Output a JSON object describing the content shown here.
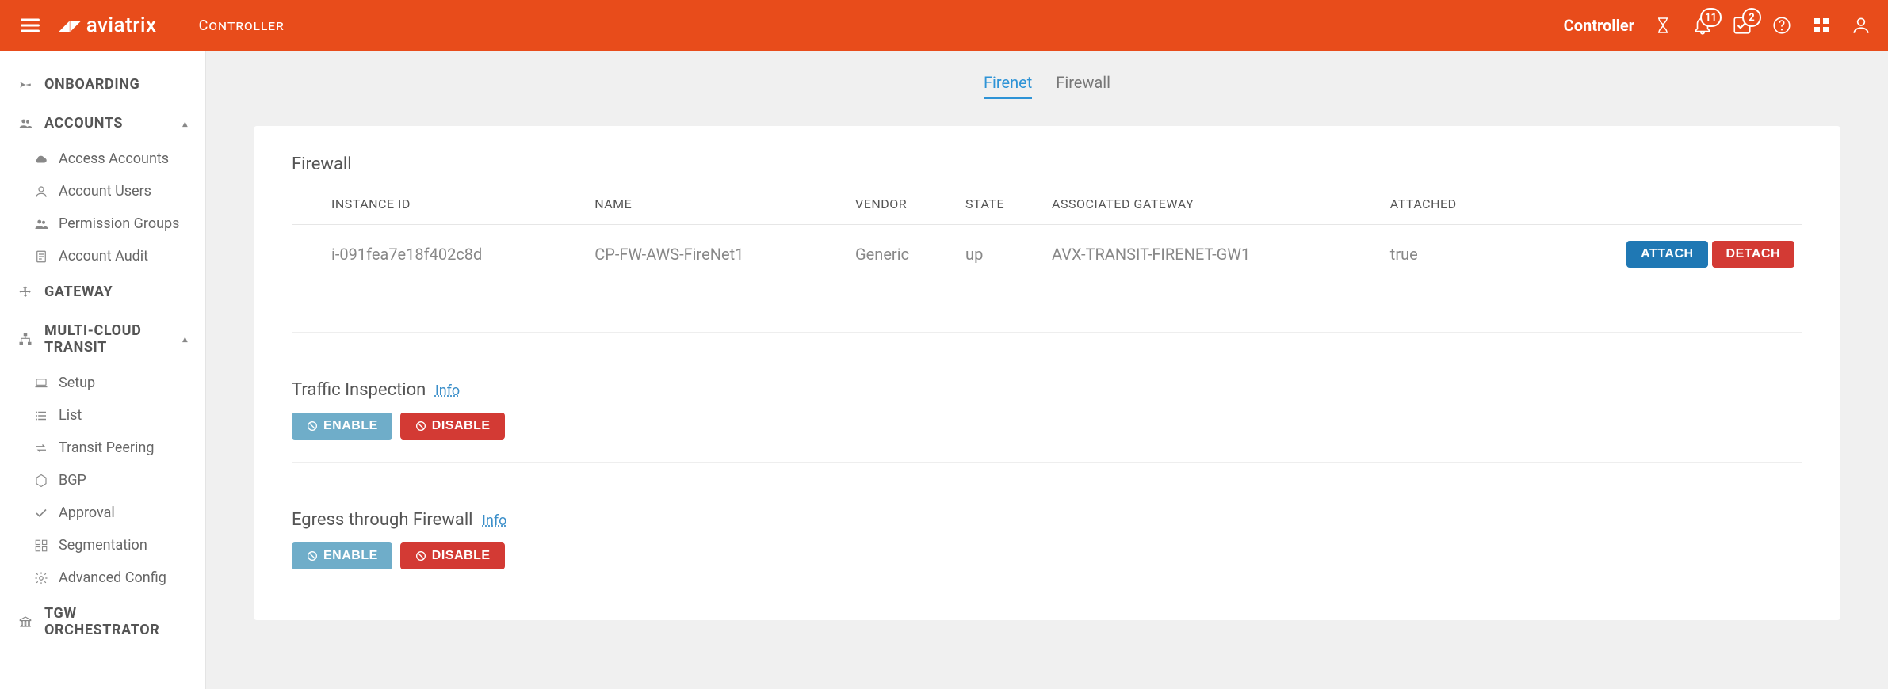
{
  "header": {
    "brand": "aviatrix",
    "section": "Controller",
    "right_label": "Controller",
    "notifications": "11",
    "tasks": "2"
  },
  "sidebar": {
    "groups": [
      {
        "label": "ONBOARDING",
        "icon": "plane",
        "items": []
      },
      {
        "label": "ACCOUNTS",
        "icon": "users",
        "expanded": true,
        "items": [
          {
            "label": "Access Accounts",
            "icon": "cloud"
          },
          {
            "label": "Account Users",
            "icon": "user"
          },
          {
            "label": "Permission Groups",
            "icon": "users"
          },
          {
            "label": "Account Audit",
            "icon": "audit"
          }
        ]
      },
      {
        "label": "GATEWAY",
        "icon": "move",
        "items": []
      },
      {
        "label": "MULTI-CLOUD TRANSIT",
        "icon": "sitemap",
        "expanded": true,
        "items": [
          {
            "label": "Setup",
            "icon": "laptop"
          },
          {
            "label": "List",
            "icon": "list"
          },
          {
            "label": "Transit Peering",
            "icon": "exchange"
          },
          {
            "label": "BGP",
            "icon": "hex"
          },
          {
            "label": "Approval",
            "icon": "check"
          },
          {
            "label": "Segmentation",
            "icon": "seg"
          },
          {
            "label": "Advanced Config",
            "icon": "gear"
          }
        ]
      },
      {
        "label": "TGW ORCHESTRATOR",
        "icon": "bank",
        "items": []
      }
    ]
  },
  "tabs": {
    "firenet": "Firenet",
    "firewall": "Firewall",
    "active": "firenet"
  },
  "firewall": {
    "title": "Firewall",
    "columns": {
      "instance": "INSTANCE ID",
      "name": "NAME",
      "vendor": "VENDOR",
      "state": "STATE",
      "gateway": "ASSOCIATED GATEWAY",
      "attached": "ATTACHED"
    },
    "rows": [
      {
        "instance_id": "i-091fea7e18f402c8d",
        "name": "CP-FW-AWS-FireNet1",
        "vendor": "Generic",
        "state": "up",
        "gateway": "AVX-TRANSIT-FIRENET-GW1",
        "attached": "true"
      }
    ],
    "actions": {
      "attach": "ATTACH",
      "detach": "DETACH"
    }
  },
  "traffic_inspection": {
    "title": "Traffic Inspection",
    "info": "Info",
    "enable": "ENABLE",
    "disable": "DISABLE"
  },
  "egress": {
    "title": "Egress through Firewall",
    "info": "Info",
    "enable": "ENABLE",
    "disable": "DISABLE"
  }
}
